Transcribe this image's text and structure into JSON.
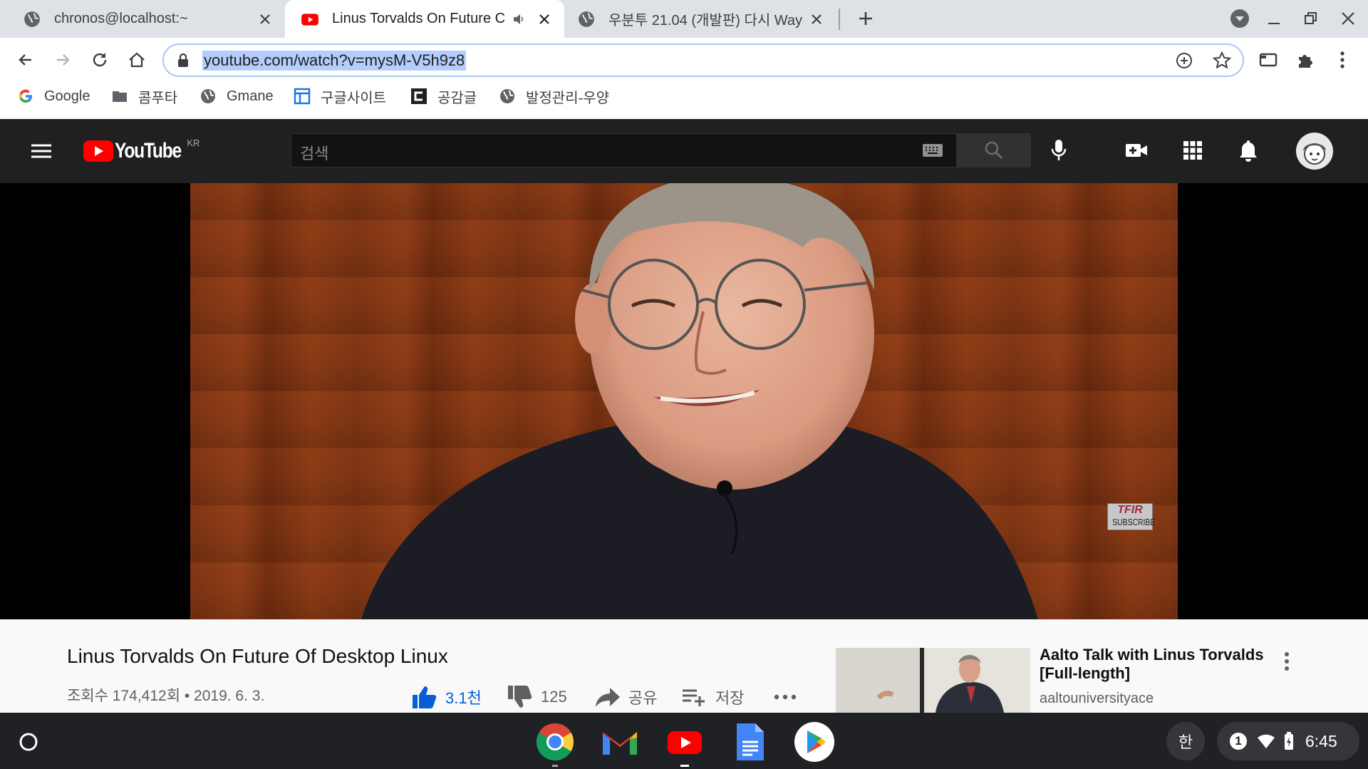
{
  "browser": {
    "tabs": [
      {
        "title": "chronos@localhost:~",
        "favicon": "globe-icon"
      },
      {
        "title": "Linus Torvalds On Future C",
        "favicon": "youtube-icon",
        "audio": "speaker-icon"
      },
      {
        "title": "우분투 21.04 (개발판) 다시 Way",
        "favicon": "globe-icon"
      }
    ],
    "url": "youtube.com/watch?v=mysM-V5h9z8",
    "bookmarks": [
      "Google",
      "콤푸타",
      "Gmane",
      "구글사이트",
      "공감글",
      "발정관리-우양"
    ]
  },
  "youtube": {
    "logo_text": "YouTube",
    "region": "KR",
    "search_placeholder": "검색",
    "watermark": {
      "line1": "TFIR",
      "line2": "SUBSCRIBE"
    }
  },
  "video": {
    "title": "Linus Torvalds On Future Of Desktop Linux",
    "meta": "조회수 174,412회 • 2019. 6. 3.",
    "likes": "3.1천",
    "dislikes": "125",
    "share_label": "공유",
    "save_label": "저장"
  },
  "recommendation": {
    "title": "Aalto Talk with Linus Torvalds [Full-length]",
    "channel": "aaltouniversityace"
  },
  "shelf": {
    "ime": "한",
    "notification_count": "1",
    "time": "6:45"
  },
  "colors": {
    "youtube_red": "#ff0000",
    "like_blue": "#065fd4",
    "header_bg": "#202020"
  }
}
